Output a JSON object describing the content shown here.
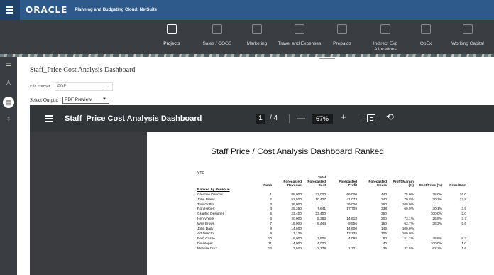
{
  "app": {
    "logo": "ORACLE",
    "product": "Planning and Budgeting Cloud: NetSuite"
  },
  "nav": [
    {
      "label": "Projects",
      "icon": "cube-icon"
    },
    {
      "label": "Sales / COGS",
      "icon": "chart-icon"
    },
    {
      "label": "Marketing",
      "icon": "megaphone-icon"
    },
    {
      "label": "Travel and Expenses",
      "icon": "id-card-icon"
    },
    {
      "label": "Prepaids",
      "icon": "calendar-icon"
    },
    {
      "label": "Indirect Exp Allocations",
      "icon": "org-chart-icon"
    },
    {
      "label": "OpEx",
      "icon": "monitor-icon"
    },
    {
      "label": "Working Capital",
      "icon": "building-icon"
    }
  ],
  "rail": [
    {
      "icon": "list-icon"
    },
    {
      "icon": "user-settings-icon"
    },
    {
      "icon": "report-icon"
    },
    {
      "icon": "tag-icon"
    }
  ],
  "page": {
    "title": "Staff_Price Cost Analysis Dashboard",
    "file_format_label": "File Format",
    "file_format_value": "PDF",
    "select_output_label": "Select Output:",
    "select_output_value": "PDF Preview"
  },
  "viewer": {
    "title": "Staff_Price Cost Analysis Dashboard",
    "page_current": "1",
    "page_total": "/ 4",
    "zoom_minus": "—",
    "zoom": "67%",
    "zoom_plus": "+"
  },
  "report": {
    "title": "Staff Price / Cost Analysis Dashboard Ranked",
    "period": "YTD",
    "ranked_by": "Ranked by Revenue",
    "columns": [
      "Rank",
      "Forecasted Revenue",
      "Total Forecasted Cost",
      "Forecasted Profit",
      "Forecasted Hours",
      "Profit Margin (%)",
      "Cost/Price (%)",
      "Price/Cost"
    ],
    "rows": [
      [
        "Creative Director",
        "1",
        "88,000",
        "22,000",
        "66,000",
        "440",
        "75.0%",
        "25.0%",
        "16.0"
      ],
      [
        "John Braud",
        "2",
        "51,500",
        "10,427",
        "41,073",
        "340",
        "79.8%",
        "20.2%",
        "22.8"
      ],
      [
        "Tom Griffin",
        "3",
        "39,000",
        "",
        "39,000",
        "260",
        "100.0%",
        "",
        ""
      ],
      [
        "Ron Hebert",
        "4",
        "25,350",
        "7,641",
        "17,709",
        "338",
        "69.9%",
        "30.1%",
        "3.9"
      ],
      [
        "Graphic Designer",
        "5",
        "23,400",
        "23,400",
        "",
        "360",
        "",
        "100.0%",
        "2.0"
      ],
      [
        "Henry York",
        "6",
        "20,000",
        "5,383",
        "14,618",
        "200",
        "73.1%",
        "26.9%",
        "3.7"
      ],
      [
        "Wes Brown",
        "7",
        "15,000",
        "5,444",
        "9,556",
        "150",
        "63.7%",
        "36.3%",
        "5.6"
      ],
      [
        "John Daily",
        "8",
        "14,600",
        "",
        "14,600",
        "146",
        "100.0%",
        "",
        ""
      ],
      [
        "Art Director",
        "9",
        "13,125",
        "",
        "13,125",
        "105",
        "100.0%",
        "",
        ""
      ],
      [
        "Beth Castle",
        "10",
        "8,000",
        "3,905",
        "4,095",
        "80",
        "51.2%",
        "48.8%",
        "8.3"
      ],
      [
        "Developer",
        "11",
        "4,000",
        "4,000",
        "",
        "40",
        "",
        "100.0%",
        "1.0"
      ],
      [
        "Melissa Cruz",
        "12",
        "3,500",
        "2,179",
        "1,321",
        "35",
        "37.8%",
        "62.2%",
        "1.6"
      ]
    ]
  }
}
